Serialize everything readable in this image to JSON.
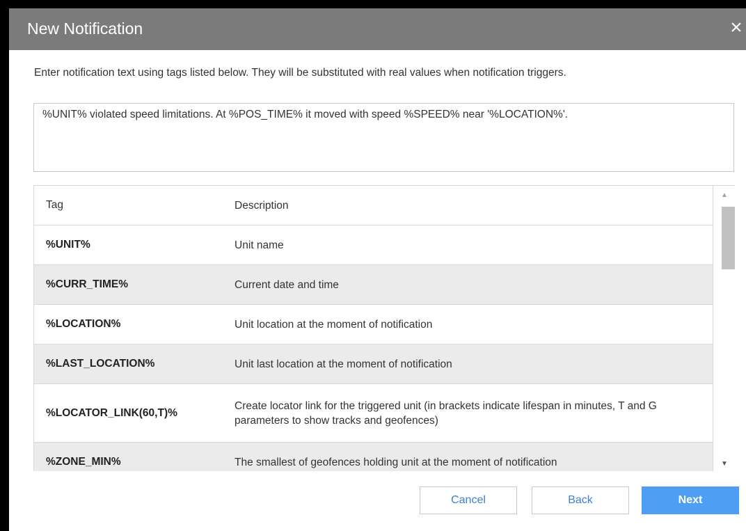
{
  "dialog": {
    "title": "New Notification",
    "close_glyph": "×",
    "instructions": "Enter notification text using tags listed below. They will be substituted with real values when notification triggers.",
    "text_value": "%UNIT% violated speed limitations. At %POS_TIME% it moved with speed %SPEED% near '%LOCATION%'."
  },
  "table": {
    "headers": {
      "tag": "Tag",
      "description": "Description"
    },
    "rows": [
      {
        "tag": "%UNIT%",
        "description": "Unit name"
      },
      {
        "tag": "%CURR_TIME%",
        "description": "Current date and time"
      },
      {
        "tag": "%LOCATION%",
        "description": "Unit location at the moment of notification"
      },
      {
        "tag": "%LAST_LOCATION%",
        "description": "Unit last location at the moment of notification"
      },
      {
        "tag": "%LOCATOR_LINK(60,T)%",
        "description": "Create locator link for the triggered unit (in brackets indicate lifespan in minutes, T and G parameters to show tracks and geofences)"
      },
      {
        "tag": "%ZONE_MIN%",
        "description": "The smallest of geofences holding unit at the moment of notification"
      }
    ]
  },
  "buttons": {
    "cancel": "Cancel",
    "back": "Back",
    "next": "Next"
  },
  "icons": {
    "close": "close-icon",
    "scroll_up": "scroll-up-arrow-icon",
    "scroll_down": "scroll-down-arrow-icon"
  },
  "colors": {
    "titlebar": "#7b7b7b",
    "accent": "#4e9ff3",
    "link_text": "#3d7fd1",
    "row_alt": "#ebebeb"
  }
}
